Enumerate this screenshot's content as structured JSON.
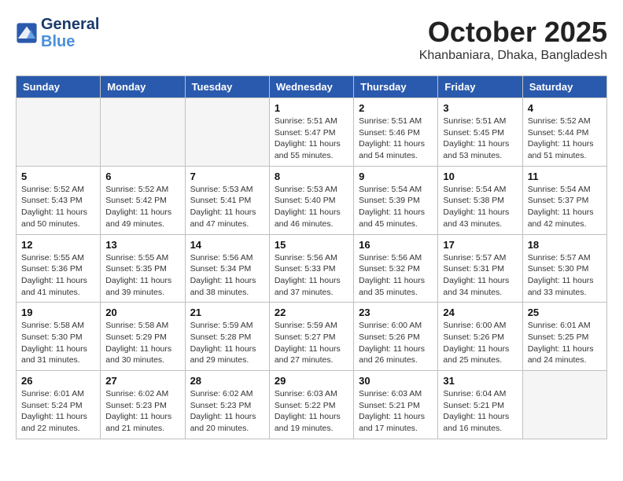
{
  "header": {
    "logo_line1": "General",
    "logo_line2": "Blue",
    "month_title": "October 2025",
    "location": "Khanbaniara, Dhaka, Bangladesh"
  },
  "weekdays": [
    "Sunday",
    "Monday",
    "Tuesday",
    "Wednesday",
    "Thursday",
    "Friday",
    "Saturday"
  ],
  "weeks": [
    [
      {
        "day": "",
        "info": ""
      },
      {
        "day": "",
        "info": ""
      },
      {
        "day": "",
        "info": ""
      },
      {
        "day": "1",
        "info": "Sunrise: 5:51 AM\nSunset: 5:47 PM\nDaylight: 11 hours\nand 55 minutes."
      },
      {
        "day": "2",
        "info": "Sunrise: 5:51 AM\nSunset: 5:46 PM\nDaylight: 11 hours\nand 54 minutes."
      },
      {
        "day": "3",
        "info": "Sunrise: 5:51 AM\nSunset: 5:45 PM\nDaylight: 11 hours\nand 53 minutes."
      },
      {
        "day": "4",
        "info": "Sunrise: 5:52 AM\nSunset: 5:44 PM\nDaylight: 11 hours\nand 51 minutes."
      }
    ],
    [
      {
        "day": "5",
        "info": "Sunrise: 5:52 AM\nSunset: 5:43 PM\nDaylight: 11 hours\nand 50 minutes."
      },
      {
        "day": "6",
        "info": "Sunrise: 5:52 AM\nSunset: 5:42 PM\nDaylight: 11 hours\nand 49 minutes."
      },
      {
        "day": "7",
        "info": "Sunrise: 5:53 AM\nSunset: 5:41 PM\nDaylight: 11 hours\nand 47 minutes."
      },
      {
        "day": "8",
        "info": "Sunrise: 5:53 AM\nSunset: 5:40 PM\nDaylight: 11 hours\nand 46 minutes."
      },
      {
        "day": "9",
        "info": "Sunrise: 5:54 AM\nSunset: 5:39 PM\nDaylight: 11 hours\nand 45 minutes."
      },
      {
        "day": "10",
        "info": "Sunrise: 5:54 AM\nSunset: 5:38 PM\nDaylight: 11 hours\nand 43 minutes."
      },
      {
        "day": "11",
        "info": "Sunrise: 5:54 AM\nSunset: 5:37 PM\nDaylight: 11 hours\nand 42 minutes."
      }
    ],
    [
      {
        "day": "12",
        "info": "Sunrise: 5:55 AM\nSunset: 5:36 PM\nDaylight: 11 hours\nand 41 minutes."
      },
      {
        "day": "13",
        "info": "Sunrise: 5:55 AM\nSunset: 5:35 PM\nDaylight: 11 hours\nand 39 minutes."
      },
      {
        "day": "14",
        "info": "Sunrise: 5:56 AM\nSunset: 5:34 PM\nDaylight: 11 hours\nand 38 minutes."
      },
      {
        "day": "15",
        "info": "Sunrise: 5:56 AM\nSunset: 5:33 PM\nDaylight: 11 hours\nand 37 minutes."
      },
      {
        "day": "16",
        "info": "Sunrise: 5:56 AM\nSunset: 5:32 PM\nDaylight: 11 hours\nand 35 minutes."
      },
      {
        "day": "17",
        "info": "Sunrise: 5:57 AM\nSunset: 5:31 PM\nDaylight: 11 hours\nand 34 minutes."
      },
      {
        "day": "18",
        "info": "Sunrise: 5:57 AM\nSunset: 5:30 PM\nDaylight: 11 hours\nand 33 minutes."
      }
    ],
    [
      {
        "day": "19",
        "info": "Sunrise: 5:58 AM\nSunset: 5:30 PM\nDaylight: 11 hours\nand 31 minutes."
      },
      {
        "day": "20",
        "info": "Sunrise: 5:58 AM\nSunset: 5:29 PM\nDaylight: 11 hours\nand 30 minutes."
      },
      {
        "day": "21",
        "info": "Sunrise: 5:59 AM\nSunset: 5:28 PM\nDaylight: 11 hours\nand 29 minutes."
      },
      {
        "day": "22",
        "info": "Sunrise: 5:59 AM\nSunset: 5:27 PM\nDaylight: 11 hours\nand 27 minutes."
      },
      {
        "day": "23",
        "info": "Sunrise: 6:00 AM\nSunset: 5:26 PM\nDaylight: 11 hours\nand 26 minutes."
      },
      {
        "day": "24",
        "info": "Sunrise: 6:00 AM\nSunset: 5:26 PM\nDaylight: 11 hours\nand 25 minutes."
      },
      {
        "day": "25",
        "info": "Sunrise: 6:01 AM\nSunset: 5:25 PM\nDaylight: 11 hours\nand 24 minutes."
      }
    ],
    [
      {
        "day": "26",
        "info": "Sunrise: 6:01 AM\nSunset: 5:24 PM\nDaylight: 11 hours\nand 22 minutes."
      },
      {
        "day": "27",
        "info": "Sunrise: 6:02 AM\nSunset: 5:23 PM\nDaylight: 11 hours\nand 21 minutes."
      },
      {
        "day": "28",
        "info": "Sunrise: 6:02 AM\nSunset: 5:23 PM\nDaylight: 11 hours\nand 20 minutes."
      },
      {
        "day": "29",
        "info": "Sunrise: 6:03 AM\nSunset: 5:22 PM\nDaylight: 11 hours\nand 19 minutes."
      },
      {
        "day": "30",
        "info": "Sunrise: 6:03 AM\nSunset: 5:21 PM\nDaylight: 11 hours\nand 17 minutes."
      },
      {
        "day": "31",
        "info": "Sunrise: 6:04 AM\nSunset: 5:21 PM\nDaylight: 11 hours\nand 16 minutes."
      },
      {
        "day": "",
        "info": ""
      }
    ]
  ]
}
